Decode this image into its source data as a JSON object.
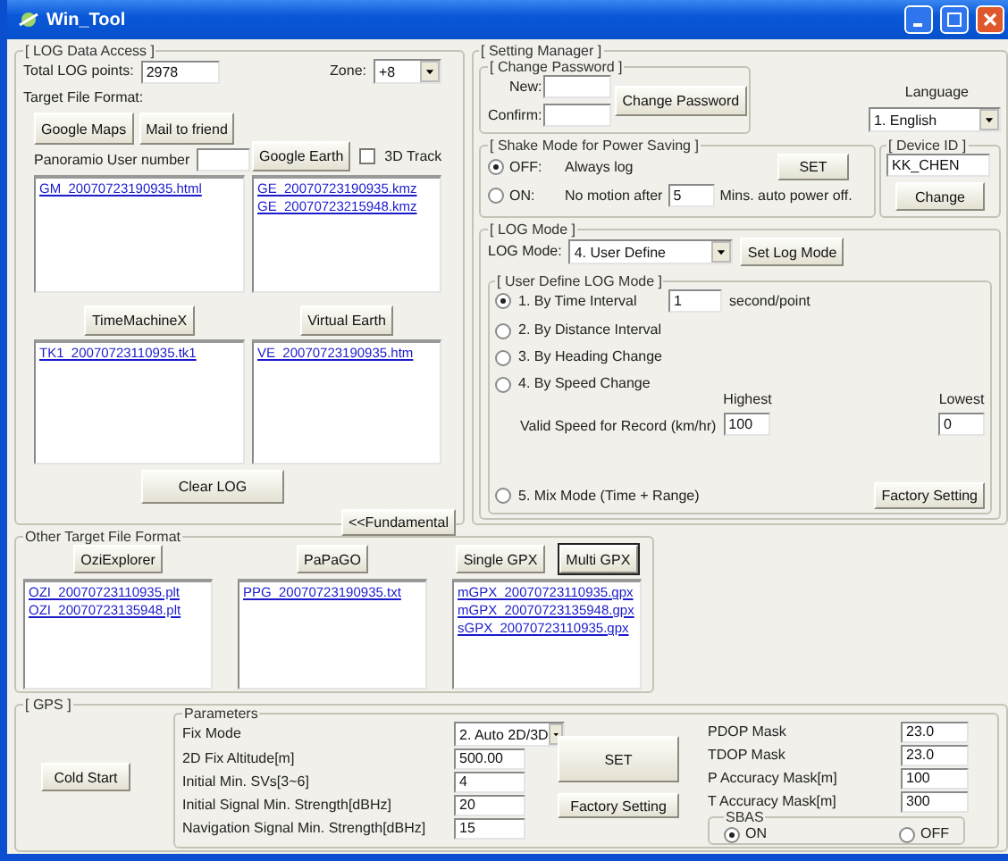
{
  "window": {
    "title": "Win_Tool"
  },
  "log_data_access": {
    "title": "[ LOG Data Access ]",
    "total_label": "Total LOG points:",
    "total_value": "2978",
    "zone_label": "Zone:",
    "zone_value": "+8",
    "format_label": "Target File Format:",
    "google_maps": {
      "buttons": [
        "Google Maps",
        "Mail to friend"
      ],
      "panoramio_label": "Panoramio User number",
      "files": [
        "GM_20070723190935.html"
      ]
    },
    "google_earth": {
      "button": "Google Earth",
      "track_label": "3D Track",
      "track_checked": false,
      "files": [
        "GE_20070723190935.kmz",
        "GE_20070723215948.kmz"
      ]
    },
    "timemachine": {
      "button": "TimeMachineX",
      "files": [
        "TK1_20070723110935.tk1"
      ]
    },
    "virtual_earth": {
      "button": "Virtual Earth",
      "files": [
        "VE_20070723190935.htm"
      ]
    },
    "clear_button": "Clear LOG",
    "fundamental_button": "<<Fundamental"
  },
  "setting_manager": {
    "title": "[ Setting Manager ]",
    "password": {
      "title": "[ Change Password ]",
      "new_label": "New:",
      "confirm_label": "Confirm:",
      "button": "Change Password"
    },
    "language": {
      "label": "Language",
      "value": "1. English"
    },
    "shake_mode": {
      "title": "[ Shake Mode for Power Saving ]",
      "options": [
        {
          "label": "OFF:",
          "desc": "Always log",
          "selected": true
        },
        {
          "label": "ON:",
          "desc": "No motion after",
          "selected": false
        }
      ],
      "minutes": "5",
      "minutes_label": "Mins. auto power off.",
      "button": "SET"
    },
    "device_id": {
      "title": "[ Device ID ]",
      "value": "KK_CHEN",
      "button": "Change"
    },
    "log_mode": {
      "title": "[ LOG Mode ]",
      "label": "LOG Mode:",
      "value": "4. User Define",
      "button": "Set Log Mode",
      "user_define": {
        "title": "[ User Define LOG Mode ]",
        "options": [
          {
            "label": "1. By Time Interval",
            "selected": true
          },
          {
            "label": "2. By Distance Interval",
            "selected": false
          },
          {
            "label": "3. By Heading Change",
            "selected": false
          },
          {
            "label": "4. By Speed Change",
            "selected": false
          },
          {
            "label": "5. Mix Mode (Time + Range)",
            "selected": false
          }
        ],
        "interval_value": "1",
        "interval_unit": "second/point",
        "highest_label": "Highest",
        "lowest_label": "Lowest",
        "speed_label": "Valid Speed for Record (km/hr)",
        "highest_value": "100",
        "lowest_value": "0",
        "factory_button": "Factory Setting"
      }
    }
  },
  "other_formats": {
    "title": "Other Target File Format",
    "groups": [
      {
        "buttons": [
          {
            "label": "OziExplorer",
            "selected": false
          }
        ],
        "files": [
          "OZI_20070723110935.plt",
          "OZI_20070723135948.plt"
        ]
      },
      {
        "buttons": [
          {
            "label": "PaPaGO",
            "selected": false
          }
        ],
        "files": [
          "PPG_20070723190935.txt"
        ]
      },
      {
        "buttons": [
          {
            "label": "Single GPX",
            "selected": false
          },
          {
            "label": "Multi GPX",
            "selected": true
          }
        ],
        "files": [
          "mGPX_20070723110935.gpx",
          "mGPX_20070723135948.gpx",
          "sGPX_20070723110935.gpx"
        ]
      }
    ]
  },
  "gps": {
    "title": "[ GPS ]",
    "cold_start": "Cold Start",
    "parameters_title": "Parameters",
    "params": [
      {
        "label": "Fix Mode",
        "value": "2. Auto 2D/3D",
        "kind": "select"
      },
      {
        "label": "2D Fix Altitude[m]",
        "value": "500.00",
        "kind": "input"
      },
      {
        "label": "Initial Min. SVs[3~6]",
        "value": "4",
        "kind": "input"
      },
      {
        "label": "Initial Signal Min. Strength[dBHz]",
        "value": "20",
        "kind": "input"
      },
      {
        "label": "Navigation Signal Min. Strength[dBHz]",
        "value": "15",
        "kind": "input"
      }
    ],
    "set_button": "SET",
    "factory_button": "Factory Setting",
    "masks": [
      {
        "label": "PDOP Mask",
        "value": "23.0"
      },
      {
        "label": "TDOP Mask",
        "value": "23.0"
      },
      {
        "label": "P Accuracy Mask[m]",
        "value": "100"
      },
      {
        "label": "T Accuracy Mask[m]",
        "value": "300"
      }
    ],
    "sbas": {
      "title": "SBAS",
      "options": [
        {
          "label": "ON",
          "selected": true
        },
        {
          "label": "OFF",
          "selected": false
        }
      ]
    }
  }
}
